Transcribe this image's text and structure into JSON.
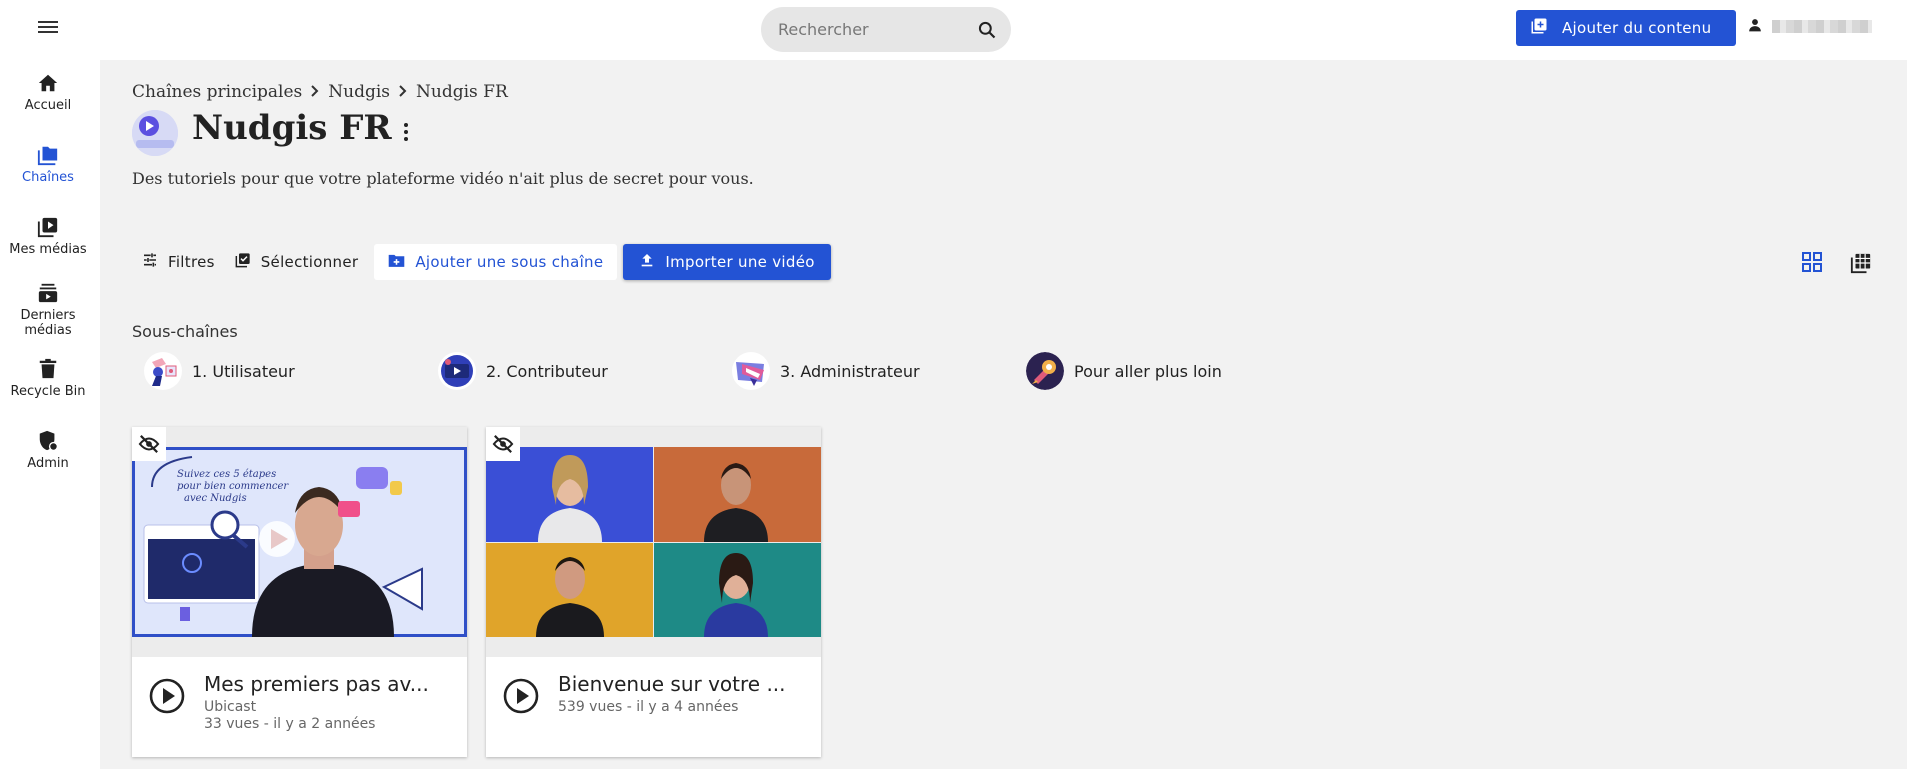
{
  "header": {
    "search_placeholder": "Rechercher",
    "add_content_label": "Ajouter du contenu"
  },
  "sidebar": {
    "items": [
      {
        "label": "Accueil",
        "icon": "home-icon"
      },
      {
        "label": "Chaînes",
        "icon": "folder-icon",
        "active": true
      },
      {
        "label": "Mes médias",
        "icon": "media-library-icon"
      },
      {
        "label": "Derniers médias",
        "icon": "latest-media-icon"
      },
      {
        "label": "Recycle Bin",
        "icon": "trash-icon"
      },
      {
        "label": "Admin",
        "icon": "admin-shield-icon"
      }
    ]
  },
  "breadcrumb": [
    "Chaînes principales",
    "Nudgis",
    "Nudgis FR"
  ],
  "channel": {
    "title": "Nudgis FR",
    "description": "Des tutoriels pour que votre plateforme vidéo n'ait plus de secret pour vous."
  },
  "toolbar": {
    "filters_label": "Filtres",
    "select_label": "Sélectionner",
    "add_subchannel_label": "Ajouter une sous chaîne",
    "import_video_label": "Importer une vidéo"
  },
  "subchannels": {
    "section_title": "Sous-chaînes",
    "items": [
      {
        "label": "1. Utilisateur"
      },
      {
        "label": "2. Contributeur"
      },
      {
        "label": "3. Administrateur"
      },
      {
        "label": "Pour aller plus loin"
      }
    ]
  },
  "videos": [
    {
      "title": "Mes premiers pas av...",
      "author": "Ubicast",
      "stats": "33 vues - il y a 2 années"
    },
    {
      "title": "Bienvenue sur votre ...",
      "stats": "539 vues - il y a 4 années"
    }
  ],
  "colors": {
    "accent": "#2353d4",
    "background": "#f2f2f2"
  }
}
